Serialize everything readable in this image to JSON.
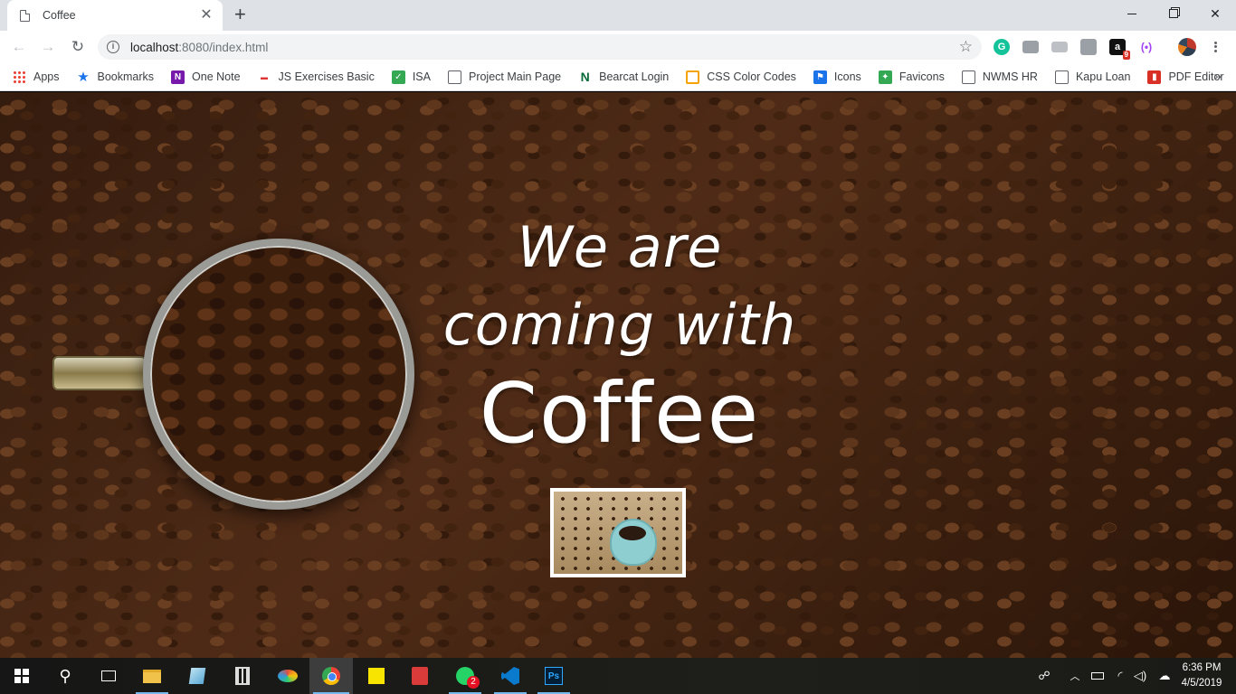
{
  "browser": {
    "tab_title": "Coffee",
    "url_host": "localhost",
    "url_rest": ":8080/index.html"
  },
  "bookmarks": [
    {
      "label": "Apps",
      "icon": "apps-grid-icon"
    },
    {
      "label": "Bookmarks",
      "icon": "star-icon"
    },
    {
      "label": "One Note",
      "icon": "onenote-icon"
    },
    {
      "label": "JS Exercises Basic",
      "icon": "js-icon"
    },
    {
      "label": "ISA",
      "icon": "check-shield-icon"
    },
    {
      "label": "Project Main Page",
      "icon": "page-icon"
    },
    {
      "label": "Bearcat Login",
      "icon": "n-logo-icon"
    },
    {
      "label": "CSS Color Codes",
      "icon": "search-circle-icon"
    },
    {
      "label": "Icons",
      "icon": "flag-icon"
    },
    {
      "label": "Favicons",
      "icon": "favicon-icon"
    },
    {
      "label": "NWMS HR",
      "icon": "page-icon"
    },
    {
      "label": "Kapu Loan",
      "icon": "page-icon"
    },
    {
      "label": "PDF Editor",
      "icon": "pdf-icon"
    }
  ],
  "extensions": {
    "grammarly": "G",
    "amazon": "a",
    "amazon_badge": "9"
  },
  "page": {
    "line1": "We are",
    "line2": "coming with",
    "line3": "Coffee"
  },
  "taskbar": {
    "whatsapp_badge": "2",
    "ps_label": "Ps",
    "time": "6:36 PM",
    "date": "4/5/2019"
  }
}
